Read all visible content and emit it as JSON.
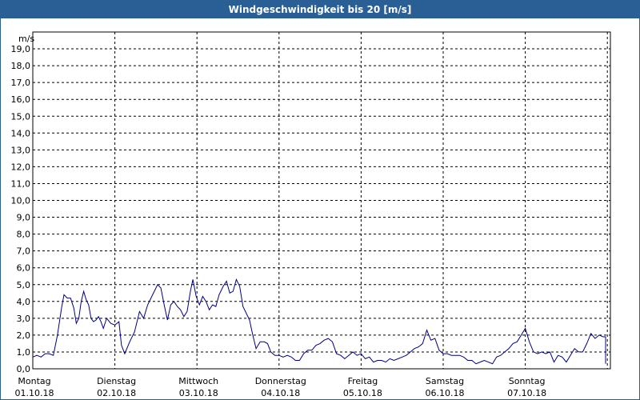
{
  "window": {
    "title": "Windgeschwindigkeit bis 20 [m/s]"
  },
  "colors": {
    "title_bar": "#2a5f95",
    "series": "#000080",
    "grid": "#000000"
  },
  "chart_data": {
    "type": "line",
    "title": "Windgeschwindigkeit bis 20 [m/s]",
    "ylabel": "m/s",
    "ylim": [
      0,
      20
    ],
    "yticks": [
      "0,0",
      "1,0",
      "2,0",
      "3,0",
      "4,0",
      "5,0",
      "6,0",
      "7,0",
      "8,0",
      "9,0",
      "10,0",
      "11,0",
      "12,0",
      "13,0",
      "14,0",
      "15,0",
      "16,0",
      "17,0",
      "18,0",
      "19,0"
    ],
    "xlim": [
      0,
      7
    ],
    "grid": true,
    "x_labels": [
      {
        "day": "Montag",
        "date": "01.10.18"
      },
      {
        "day": "Dienstag",
        "date": "02.10.18"
      },
      {
        "day": "Mittwoch",
        "date": "03.10.18"
      },
      {
        "day": "Donnerstag",
        "date": "04.10.18"
      },
      {
        "day": "Freitag",
        "date": "05.10.18"
      },
      {
        "day": "Samstag",
        "date": "06.10.18"
      },
      {
        "day": "Sonntag",
        "date": "07.10.18"
      }
    ],
    "series": [
      {
        "values": [
          [
            0.0,
            0.7
          ],
          [
            0.05,
            0.8
          ],
          [
            0.1,
            0.7
          ],
          [
            0.15,
            0.9
          ],
          [
            0.2,
            0.9
          ],
          [
            0.25,
            0.8
          ],
          [
            0.3,
            2.0
          ],
          [
            0.35,
            3.6
          ],
          [
            0.38,
            4.4
          ],
          [
            0.42,
            4.2
          ],
          [
            0.46,
            4.2
          ],
          [
            0.5,
            3.6
          ],
          [
            0.53,
            2.7
          ],
          [
            0.56,
            3.0
          ],
          [
            0.59,
            4.0
          ],
          [
            0.62,
            4.6
          ],
          [
            0.65,
            4.1
          ],
          [
            0.68,
            3.8
          ],
          [
            0.71,
            3.0
          ],
          [
            0.74,
            2.8
          ],
          [
            0.77,
            2.9
          ],
          [
            0.8,
            3.1
          ],
          [
            0.83,
            2.8
          ],
          [
            0.86,
            2.4
          ],
          [
            0.9,
            3.0
          ],
          [
            0.95,
            2.7
          ],
          [
            1.0,
            2.6
          ],
          [
            1.05,
            2.8
          ],
          [
            1.08,
            1.4
          ],
          [
            1.12,
            0.9
          ],
          [
            1.18,
            1.6
          ],
          [
            1.24,
            2.2
          ],
          [
            1.3,
            3.4
          ],
          [
            1.35,
            3.0
          ],
          [
            1.4,
            3.8
          ],
          [
            1.46,
            4.4
          ],
          [
            1.52,
            5.0
          ],
          [
            1.56,
            4.8
          ],
          [
            1.6,
            3.8
          ],
          [
            1.64,
            2.9
          ],
          [
            1.68,
            3.8
          ],
          [
            1.72,
            4.0
          ],
          [
            1.76,
            3.7
          ],
          [
            1.8,
            3.5
          ],
          [
            1.84,
            3.1
          ],
          [
            1.88,
            3.4
          ],
          [
            1.92,
            4.6
          ],
          [
            1.95,
            5.3
          ],
          [
            1.99,
            4.3
          ],
          [
            2.03,
            3.8
          ],
          [
            2.07,
            4.3
          ],
          [
            2.11,
            4.0
          ],
          [
            2.15,
            3.5
          ],
          [
            2.19,
            3.8
          ],
          [
            2.23,
            3.7
          ],
          [
            2.27,
            4.4
          ],
          [
            2.32,
            4.9
          ],
          [
            2.36,
            5.2
          ],
          [
            2.4,
            4.5
          ],
          [
            2.44,
            4.6
          ],
          [
            2.48,
            5.3
          ],
          [
            2.52,
            4.9
          ],
          [
            2.56,
            3.7
          ],
          [
            2.6,
            3.3
          ],
          [
            2.64,
            2.9
          ],
          [
            2.68,
            2.0
          ],
          [
            2.72,
            1.2
          ],
          [
            2.77,
            1.6
          ],
          [
            2.82,
            1.6
          ],
          [
            2.86,
            1.5
          ],
          [
            2.9,
            1.0
          ],
          [
            2.95,
            0.8
          ],
          [
            3.0,
            0.8
          ],
          [
            3.05,
            0.7
          ],
          [
            3.1,
            0.8
          ],
          [
            3.15,
            0.7
          ],
          [
            3.2,
            0.5
          ],
          [
            3.25,
            0.5
          ],
          [
            3.3,
            0.9
          ],
          [
            3.35,
            1.1
          ],
          [
            3.4,
            1.1
          ],
          [
            3.45,
            1.4
          ],
          [
            3.5,
            1.5
          ],
          [
            3.55,
            1.7
          ],
          [
            3.6,
            1.8
          ],
          [
            3.65,
            1.6
          ],
          [
            3.7,
            0.9
          ],
          [
            3.75,
            0.8
          ],
          [
            3.8,
            0.6
          ],
          [
            3.85,
            0.8
          ],
          [
            3.9,
            1.0
          ],
          [
            3.95,
            0.8
          ],
          [
            4.0,
            0.9
          ],
          [
            4.05,
            0.6
          ],
          [
            4.1,
            0.7
          ],
          [
            4.15,
            0.4
          ],
          [
            4.2,
            0.5
          ],
          [
            4.25,
            0.5
          ],
          [
            4.3,
            0.4
          ],
          [
            4.35,
            0.6
          ],
          [
            4.4,
            0.5
          ],
          [
            4.45,
            0.6
          ],
          [
            4.5,
            0.7
          ],
          [
            4.55,
            0.8
          ],
          [
            4.6,
            1.0
          ],
          [
            4.65,
            1.2
          ],
          [
            4.7,
            1.3
          ],
          [
            4.75,
            1.5
          ],
          [
            4.8,
            2.3
          ],
          [
            4.85,
            1.7
          ],
          [
            4.9,
            1.8
          ],
          [
            4.95,
            1.1
          ],
          [
            5.0,
            0.9
          ],
          [
            5.05,
            0.9
          ],
          [
            5.1,
            0.8
          ],
          [
            5.15,
            0.8
          ],
          [
            5.2,
            0.8
          ],
          [
            5.25,
            0.7
          ],
          [
            5.3,
            0.5
          ],
          [
            5.35,
            0.5
          ],
          [
            5.4,
            0.3
          ],
          [
            5.45,
            0.4
          ],
          [
            5.5,
            0.5
          ],
          [
            5.55,
            0.4
          ],
          [
            5.6,
            0.3
          ],
          [
            5.65,
            0.7
          ],
          [
            5.7,
            0.8
          ],
          [
            5.75,
            1.0
          ],
          [
            5.8,
            1.2
          ],
          [
            5.85,
            1.5
          ],
          [
            5.9,
            1.6
          ],
          [
            5.95,
            2.0
          ],
          [
            6.0,
            2.4
          ],
          [
            6.05,
            1.6
          ],
          [
            6.1,
            1.0
          ],
          [
            6.15,
            0.9
          ],
          [
            6.2,
            1.0
          ],
          [
            6.25,
            0.9
          ],
          [
            6.3,
            1.0
          ],
          [
            6.35,
            0.4
          ],
          [
            6.4,
            0.8
          ],
          [
            6.45,
            0.7
          ],
          [
            6.5,
            0.4
          ],
          [
            6.55,
            0.8
          ],
          [
            6.6,
            1.2
          ],
          [
            6.65,
            1.0
          ],
          [
            6.7,
            1.0
          ],
          [
            6.75,
            1.5
          ],
          [
            6.8,
            2.1
          ],
          [
            6.85,
            1.8
          ],
          [
            6.9,
            2.0
          ],
          [
            6.95,
            1.9
          ],
          [
            7.0,
            1.9
          ],
          [
            7.05,
            1.6
          ],
          [
            7.1,
            0.9
          ],
          [
            7.15,
            0.8
          ],
          [
            7.2,
            0.6
          ],
          [
            7.25,
            0.8
          ],
          [
            7.3,
            0.6
          ],
          [
            7.35,
            0.3
          ]
        ]
      }
    ]
  }
}
